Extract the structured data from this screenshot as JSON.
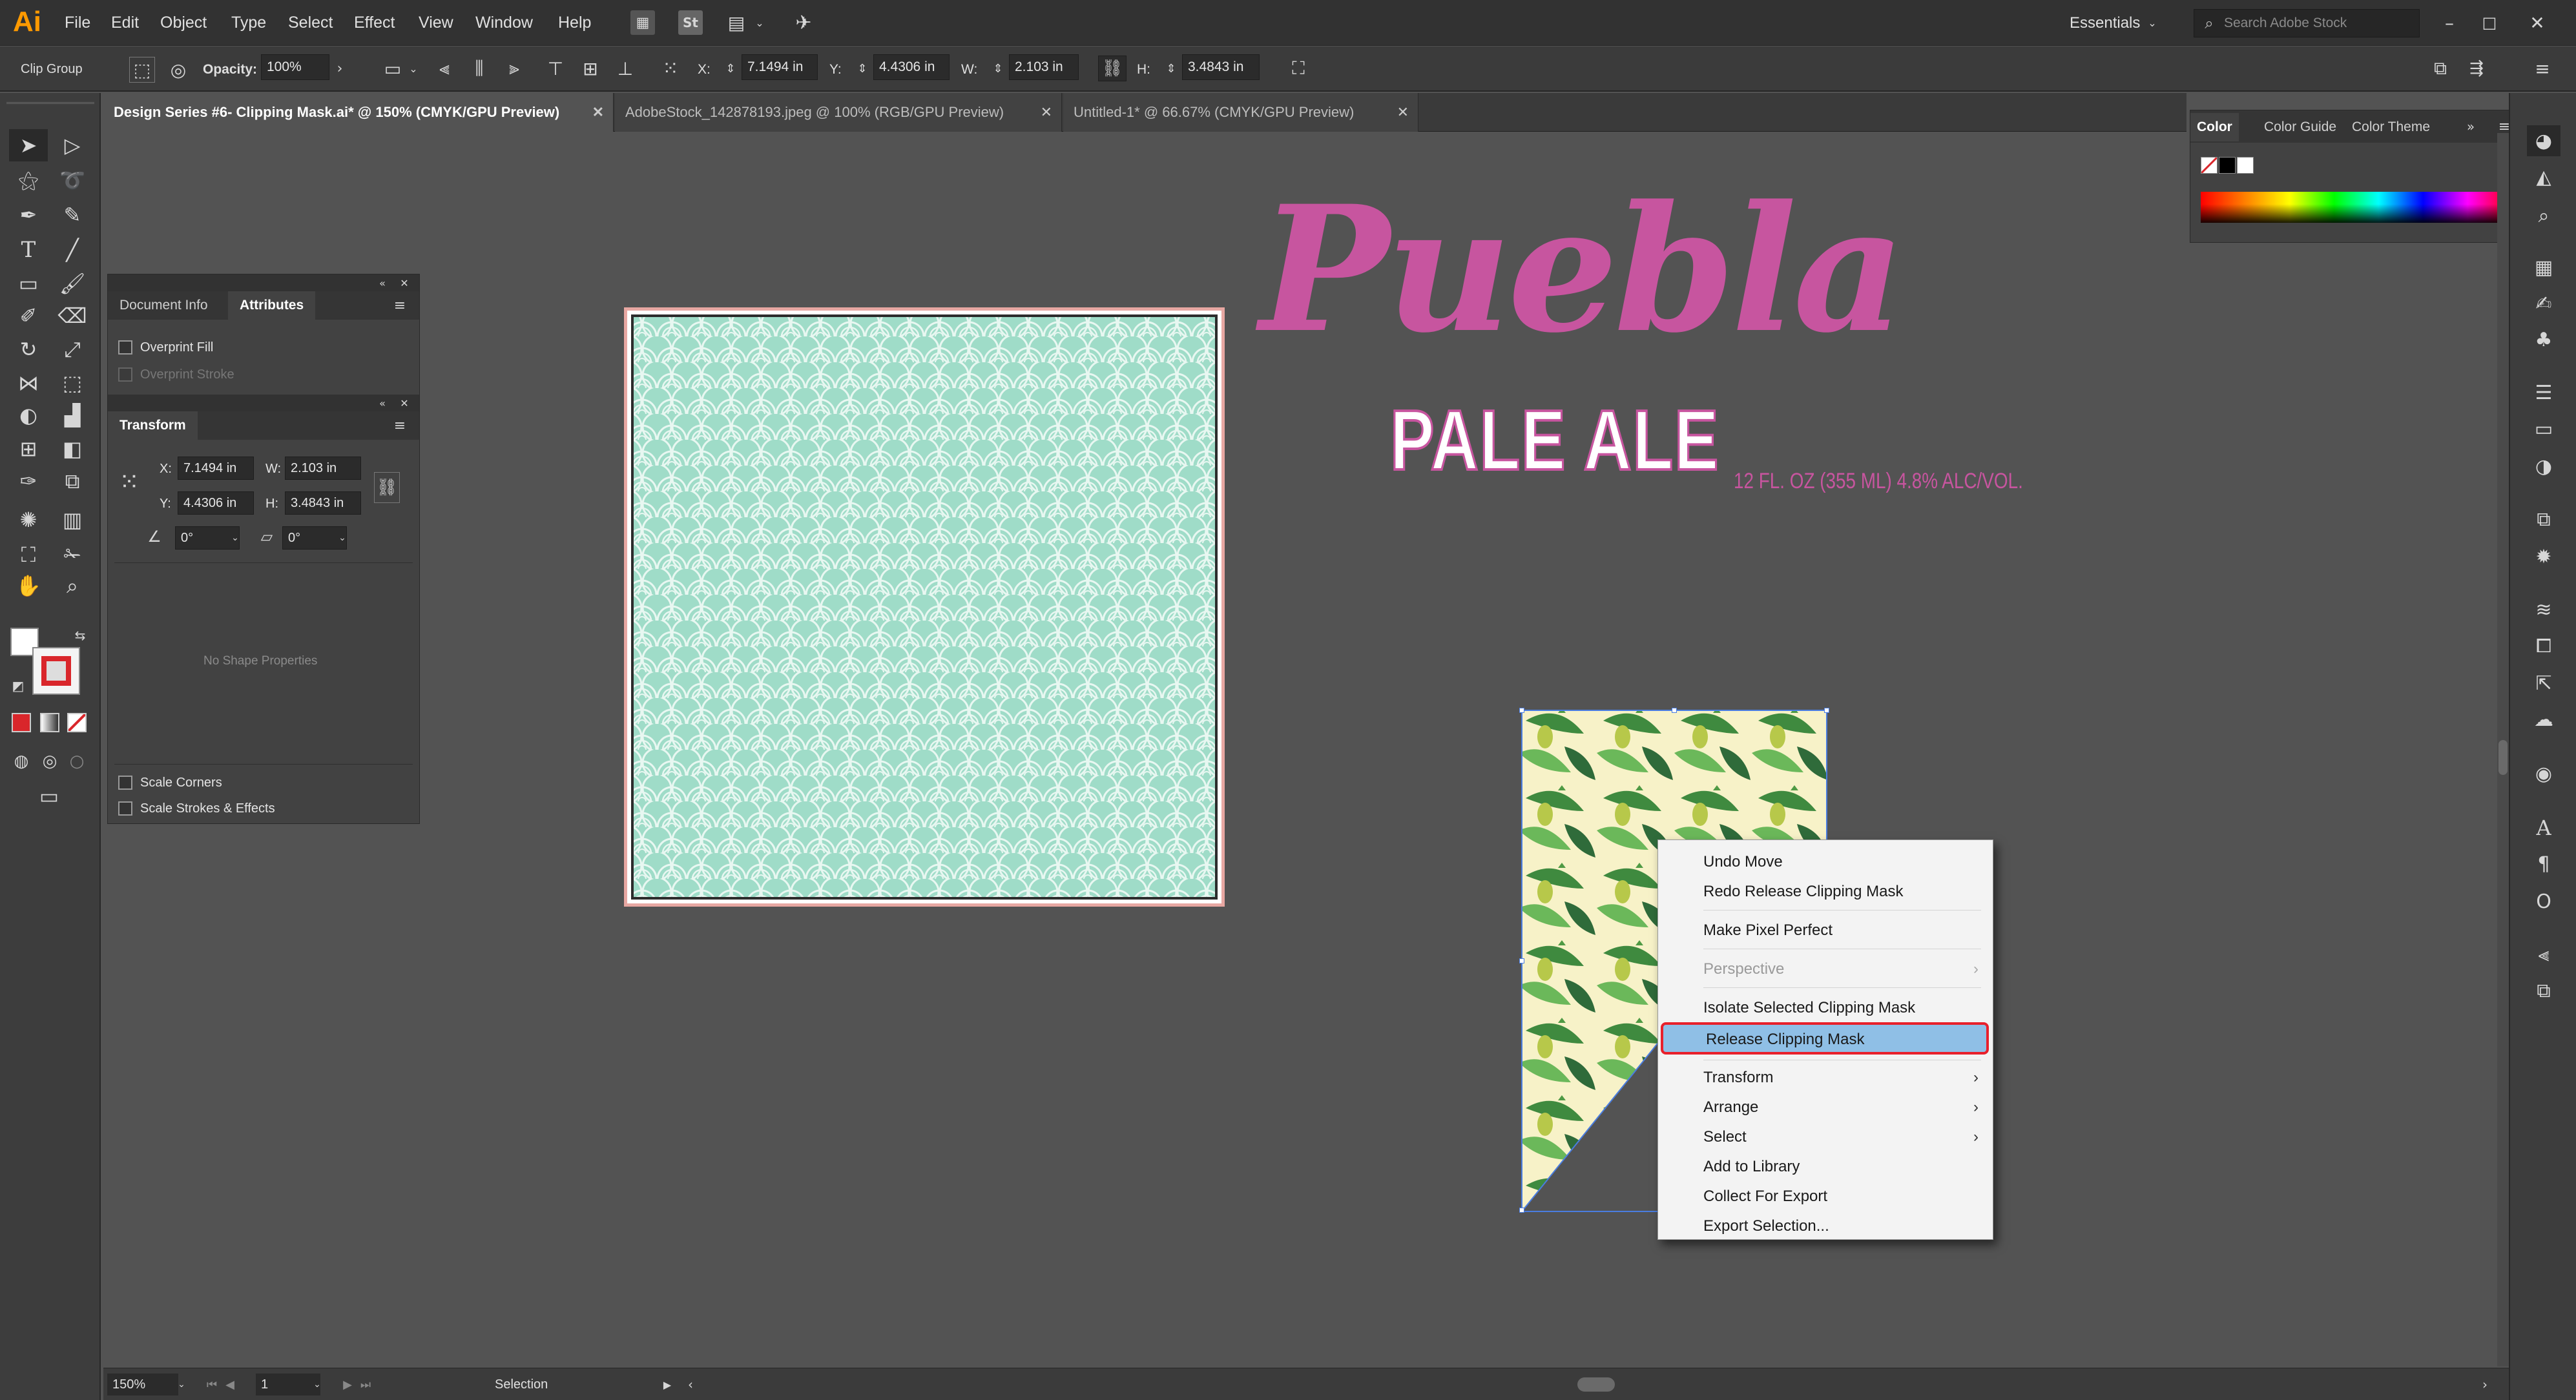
{
  "app": {
    "logo": "Ai"
  },
  "menubar": {
    "items": [
      "File",
      "Edit",
      "Object",
      "Type",
      "Select",
      "Effect",
      "View",
      "Window",
      "Help"
    ],
    "workspace": "Essentials",
    "search_placeholder": "Search Adobe Stock"
  },
  "control_bar": {
    "selection_type": "Clip Group",
    "opacity_label": "Opacity:",
    "opacity_value": "100%",
    "x_label": "X:",
    "x_value": "7.1494 in",
    "y_label": "Y:",
    "y_value": "4.4306 in",
    "w_label": "W:",
    "w_value": "2.103 in",
    "h_label": "H:",
    "h_value": "3.4843 in"
  },
  "tabs": [
    {
      "label": "Design Series #6- Clipping Mask.ai* @ 150% (CMYK/GPU Preview)",
      "active": true
    },
    {
      "label": "AdobeStock_142878193.jpeg @ 100% (RGB/GPU Preview)",
      "active": false
    },
    {
      "label": "Untitled-1* @ 66.67% (CMYK/GPU Preview)",
      "active": false
    }
  ],
  "attributes_panel": {
    "tabs": [
      "Document Info",
      "Attributes"
    ],
    "overprint_fill": "Overprint Fill",
    "overprint_stroke": "Overprint Stroke"
  },
  "transform_panel": {
    "title": "Transform",
    "x_label": "X:",
    "x_value": "7.1494 in",
    "y_label": "Y:",
    "y_value": "4.4306 in",
    "w_label": "W:",
    "w_value": "2.103 in",
    "h_label": "H:",
    "h_value": "3.4843 in",
    "rotate_value": "0°",
    "shear_value": "0°",
    "no_shape": "No Shape Properties",
    "scale_corners": "Scale Corners",
    "scale_strokes": "Scale Strokes & Effects"
  },
  "color_panel": {
    "tabs": [
      "Color",
      "Color Guide",
      "Color Theme"
    ]
  },
  "artwork": {
    "brand": "Puebla",
    "style": "PALE ALE",
    "info": "12 FL. OZ (355 ML) 4.8% ALC/VOL.",
    "brand_color": "#c7559f",
    "pattern_color": "#9fdcc8"
  },
  "context_menu": {
    "items": [
      {
        "label": "Undo Move"
      },
      {
        "label": "Redo Release Clipping Mask"
      },
      {
        "label": "Make Pixel Perfect"
      },
      {
        "label": "Perspective",
        "disabled": true,
        "submenu": true
      },
      {
        "label": "Isolate Selected Clipping Mask"
      },
      {
        "label": "Release Clipping Mask",
        "highlighted": true
      },
      {
        "label": "Transform",
        "submenu": true
      },
      {
        "label": "Arrange",
        "submenu": true
      },
      {
        "label": "Select",
        "submenu": true
      },
      {
        "label": "Add to Library"
      },
      {
        "label": "Collect For Export"
      },
      {
        "label": "Export Selection..."
      }
    ],
    "highlight_color": "#8fbfe6",
    "outline_color": "#e8202b"
  },
  "status_bar": {
    "zoom": "150%",
    "artboard": "1",
    "tool": "Selection"
  }
}
